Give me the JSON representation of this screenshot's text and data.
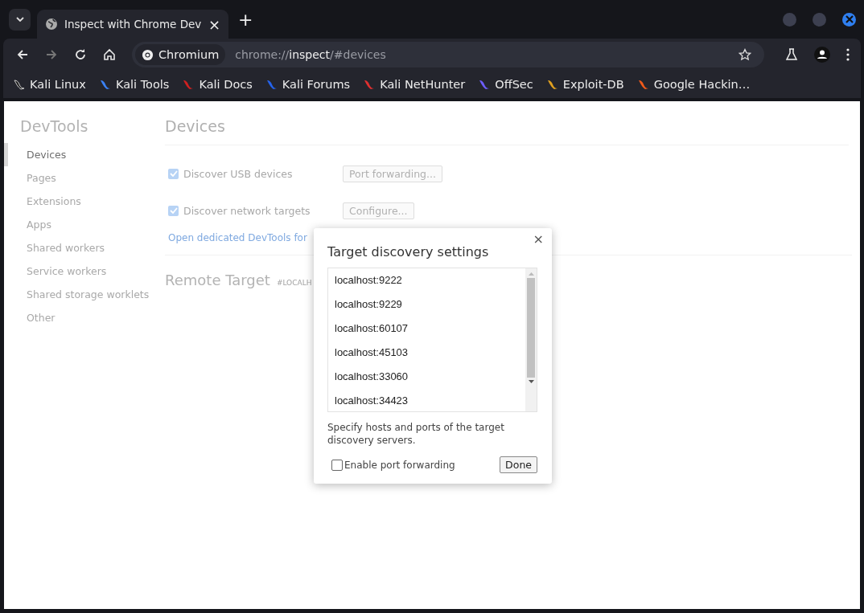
{
  "browser": {
    "tab": {
      "title": "Inspect with Chrome Dev",
      "close": "×"
    },
    "new_tab": "+",
    "site_chip": "Chromium",
    "url": {
      "scheme": "chrome://",
      "host": "inspect",
      "path": "/#devices"
    },
    "bookmarks": [
      {
        "label": "Kali Linux"
      },
      {
        "label": "Kali Tools"
      },
      {
        "label": "Kali Docs"
      },
      {
        "label": "Kali Forums"
      },
      {
        "label": "Kali NetHunter"
      },
      {
        "label": "OffSec"
      },
      {
        "label": "Exploit-DB"
      },
      {
        "label": "Google Hackin…"
      }
    ]
  },
  "sidebar": {
    "title": "DevTools",
    "items": [
      {
        "label": "Devices",
        "selected": true
      },
      {
        "label": "Pages",
        "selected": false
      },
      {
        "label": "Extensions",
        "selected": false
      },
      {
        "label": "Apps",
        "selected": false
      },
      {
        "label": "Shared workers",
        "selected": false
      },
      {
        "label": "Service workers",
        "selected": false
      },
      {
        "label": "Shared storage worklets",
        "selected": false
      },
      {
        "label": "Other",
        "selected": false
      }
    ]
  },
  "main": {
    "title": "Devices",
    "options": [
      {
        "label": "Discover USB devices",
        "checked": true,
        "button": "Port forwarding..."
      },
      {
        "label": "Discover network targets",
        "checked": true,
        "button": "Configure..."
      }
    ],
    "link": "Open dedicated DevTools for",
    "remote": {
      "title": "Remote Target",
      "subtitle": "#LOCALH"
    }
  },
  "dialog": {
    "title": "Target discovery settings",
    "close": "×",
    "entries": [
      "localhost:9222",
      "localhost:9229",
      "localhost:60107",
      "localhost:45103",
      "localhost:33060",
      "localhost:34423"
    ],
    "hint": "Specify hosts and ports of the target discovery servers.",
    "port_forwarding": {
      "label": "Enable port forwarding",
      "checked": false
    },
    "done": "Done"
  }
}
